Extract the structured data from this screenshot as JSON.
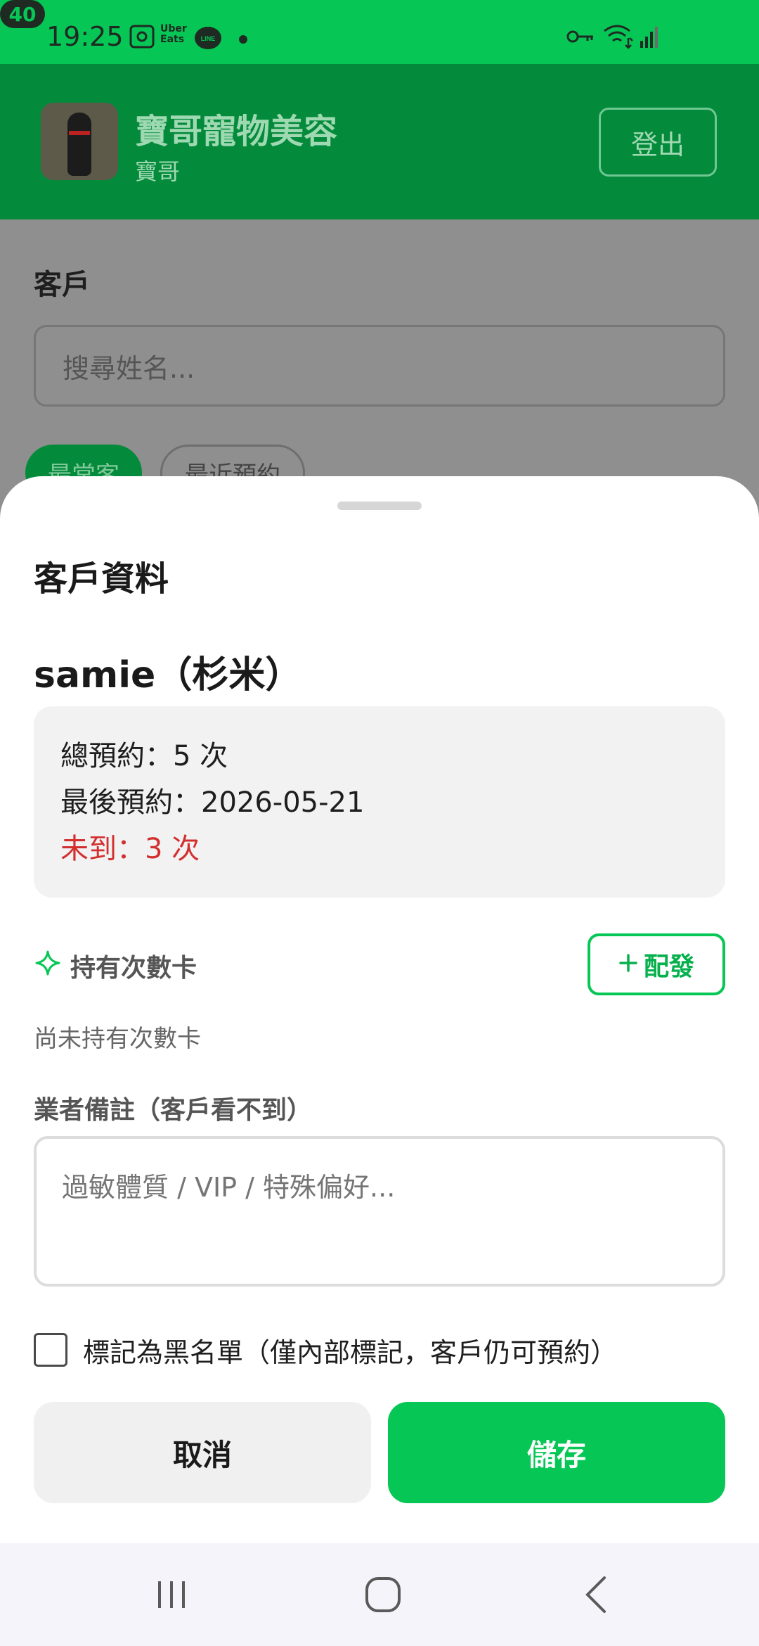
{
  "status_bar": {
    "time": "19:25",
    "ubereats_line1": "Uber",
    "ubereats_line2": "Eats",
    "line_badge": "LINE",
    "battery": "40"
  },
  "header": {
    "shop_name": "寶哥寵物美容",
    "user_name": "寶哥",
    "logout_label": "登出"
  },
  "background_page": {
    "section_title": "客戶",
    "search_placeholder": "搜尋姓名...",
    "chips": [
      "最常客",
      "最近預約"
    ]
  },
  "sheet": {
    "title": "客戶資料",
    "customer_name": "samie（杉米）",
    "stats": {
      "total_bookings": "總預約：5 次",
      "last_booking": "最後預約：2026-05-21",
      "no_show": "未到：3 次"
    },
    "cards_label": "持有次數卡",
    "issue_label": "配發",
    "no_cards_text": "尚未持有次數卡",
    "notes_label": "業者備註（客戶看不到）",
    "notes_placeholder": "過敏體質 / VIP / 特殊偏好...",
    "blacklist_label": "標記為黑名單（僅內部標記，客戶仍可預約）",
    "cancel_label": "取消",
    "save_label": "儲存"
  },
  "colors": {
    "brand_green": "#06c755",
    "no_show_red": "#d32f2f"
  },
  "icons": [
    "screenshot-icon",
    "line-icon",
    "key-icon",
    "wifi-icon",
    "signal-icon",
    "sparkle-icon",
    "plus-icon",
    "recents-icon",
    "home-icon",
    "back-icon"
  ]
}
